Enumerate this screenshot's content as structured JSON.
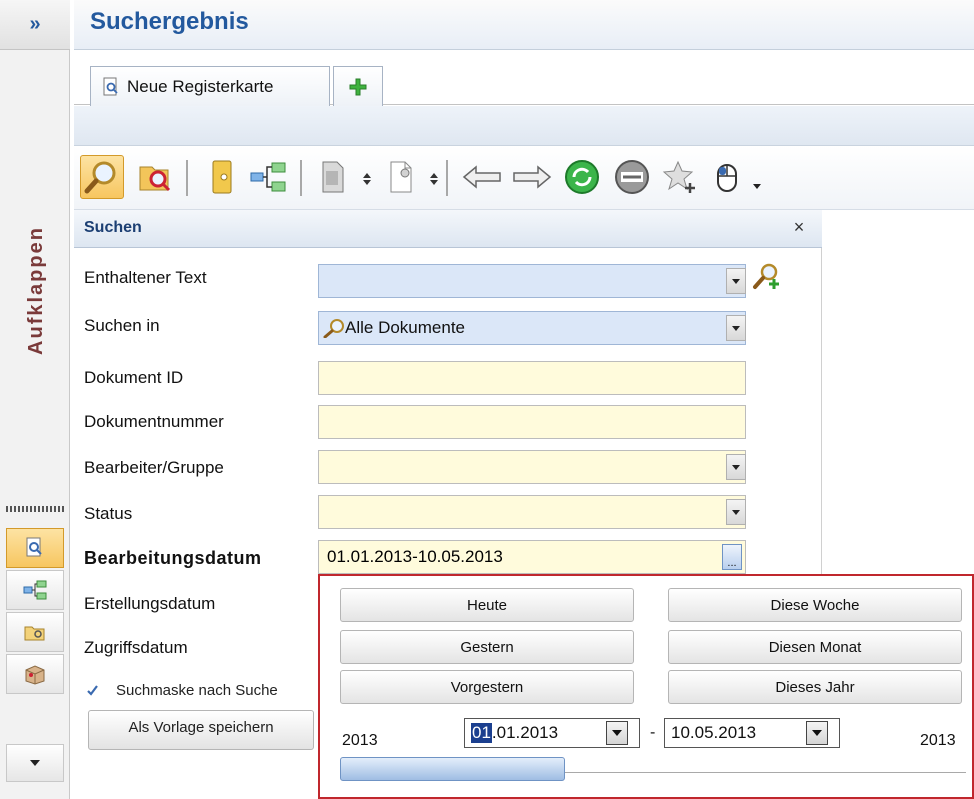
{
  "rail": {
    "expand_label": "»",
    "collapse_label": "Aufklappen"
  },
  "header": {
    "title": "Suchergebnis"
  },
  "tabs": [
    {
      "label": "Neue Registerkarte"
    }
  ],
  "panel": {
    "title": "Suchen",
    "close_label": "×",
    "fields": {
      "contained_text": {
        "label": "Enthaltener Text",
        "value": ""
      },
      "search_in": {
        "label": "Suchen in",
        "value": "Alle Dokumente"
      },
      "document_id": {
        "label": "Dokument ID",
        "value": ""
      },
      "document_number": {
        "label": "Dokumentnummer",
        "value": ""
      },
      "editor_group": {
        "label": "Bearbeiter/Gruppe",
        "value": ""
      },
      "status": {
        "label": "Status",
        "value": ""
      },
      "edit_date": {
        "label": "Bearbeitungsdatum",
        "value": "01.01.2013-10.05.2013",
        "browse": "..."
      },
      "creation_date": {
        "label": "Erstellungsdatum"
      },
      "access_date": {
        "label": "Zugriffsdatum"
      }
    },
    "checkbox_label": "Suchmaske nach Suche",
    "checkbox_checked": true,
    "save_template_label": "Als Vorlage speichern"
  },
  "date_popup": {
    "buttons": {
      "today": "Heute",
      "yesterday": "Gestern",
      "day_before": "Vorgestern",
      "this_week": "Diese Woche",
      "this_month": "Diesen Monat",
      "this_year": "Dieses Jahr"
    },
    "year_left": "2013",
    "year_right": "2013",
    "from_day": "01",
    "from_rest": ".01.2013",
    "separator": "-",
    "to_date": "10.05.2013",
    "slider_range": [
      0.0,
      0.36
    ]
  },
  "colors": {
    "title_blue": "#23599e",
    "field_yellow": "#fffbdc",
    "field_blue": "#dbe7f8",
    "popup_border": "#c0272d",
    "active_orange": "#f7c660"
  },
  "icons": [
    "search-icon",
    "find-similar-icon",
    "binder-icon",
    "tree-icon",
    "export-icon",
    "new-document-icon",
    "back-arrow-icon",
    "forward-arrow-icon",
    "refresh-icon",
    "stop-icon",
    "favorite-star-icon",
    "mouse-icon",
    "add-search-icon",
    "add-tab-icon"
  ]
}
